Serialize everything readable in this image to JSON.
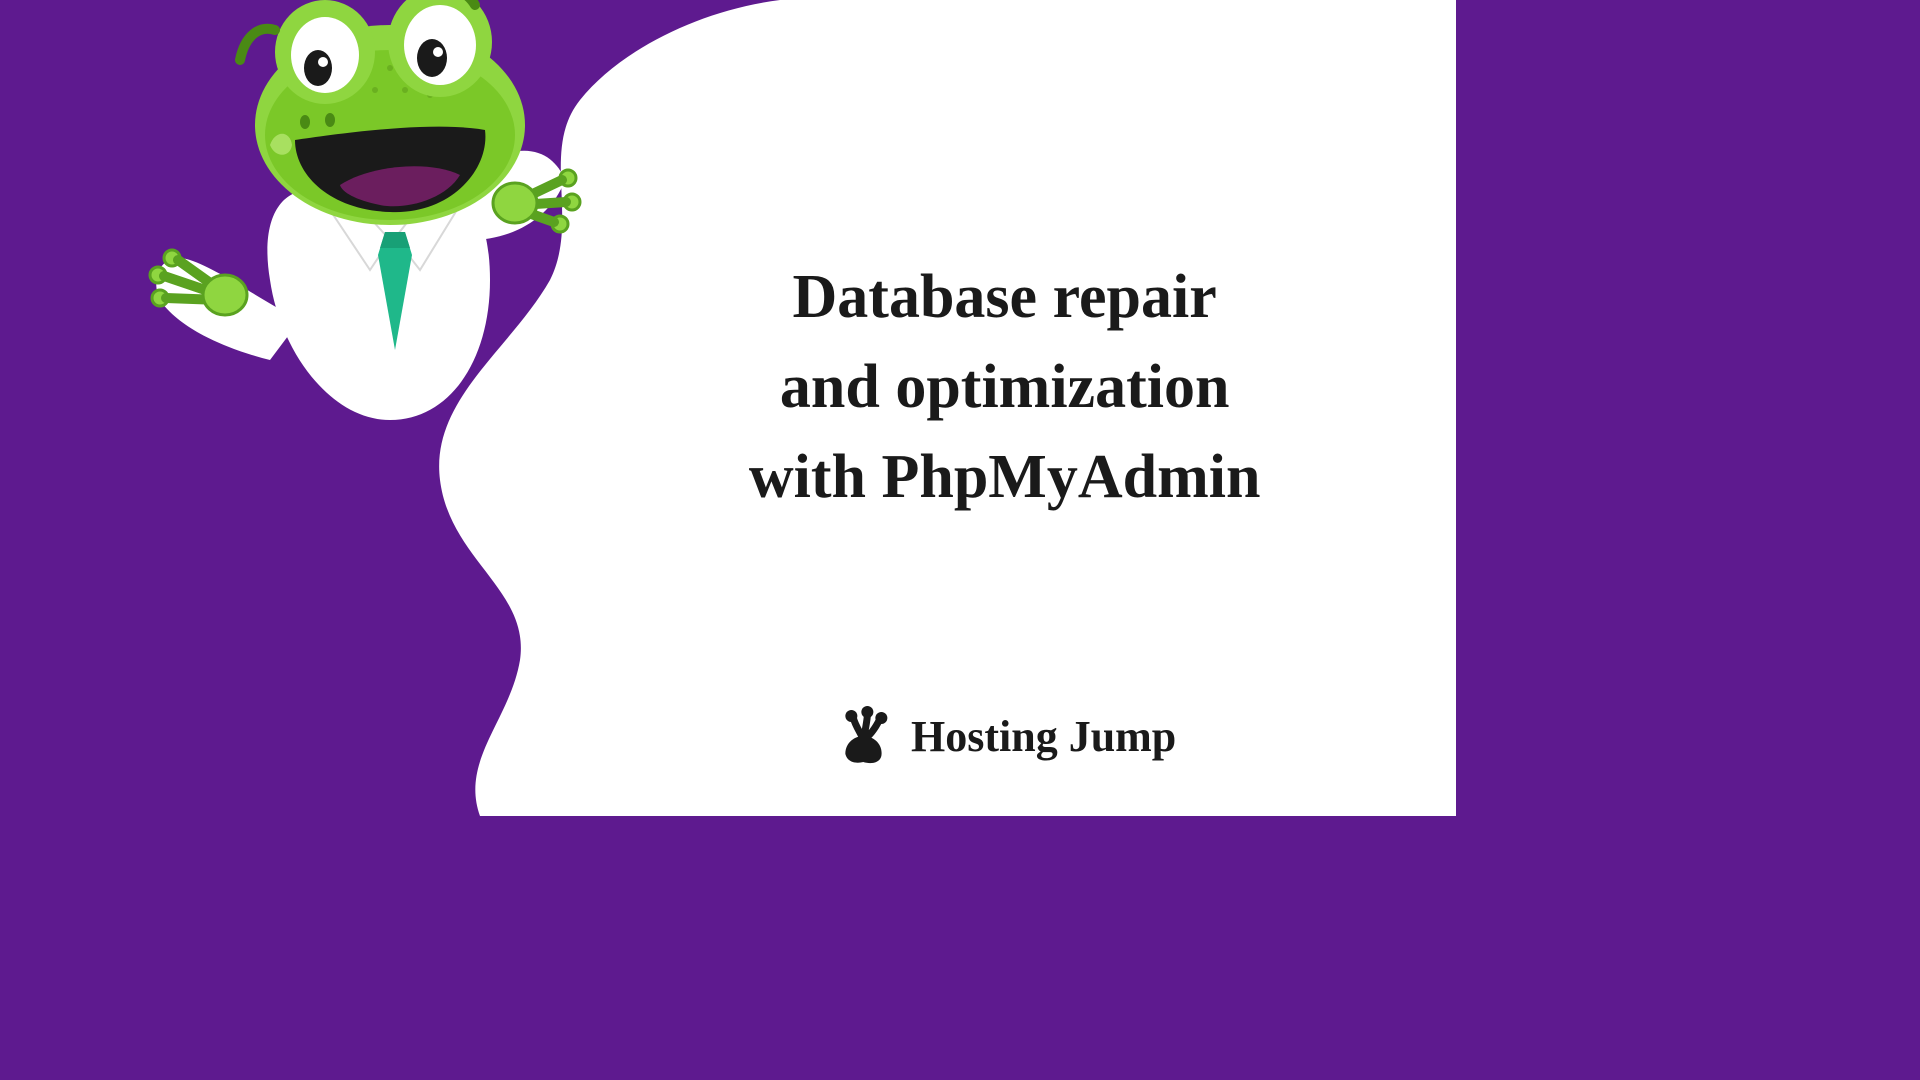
{
  "heading": {
    "line1": "Database repair",
    "line2": "and optimization",
    "line3": "with PhpMyAdmin"
  },
  "brand": {
    "name": "Hosting Jump"
  },
  "colors": {
    "purple": "#5e1a8f",
    "frog_green_light": "#8fd640",
    "frog_green_dark": "#5aa220",
    "tie_teal": "#1fb88a",
    "text": "#1a1a1a"
  }
}
